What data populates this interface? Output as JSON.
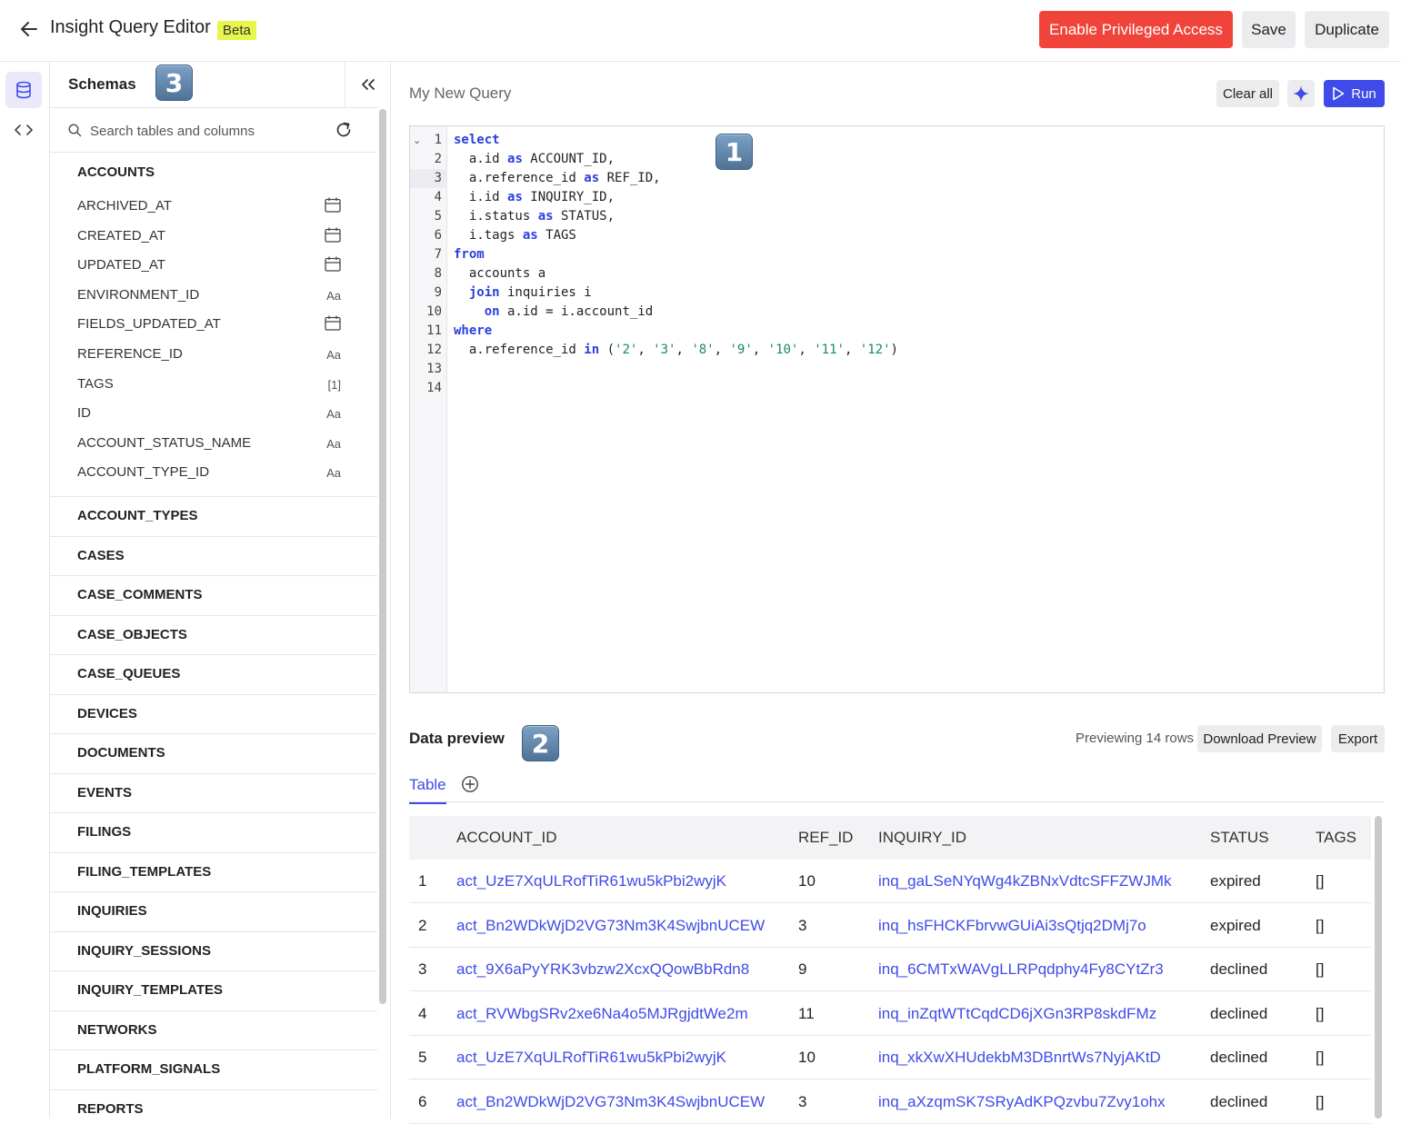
{
  "header": {
    "title": "Insight Query Editor",
    "badge": "Beta",
    "privileged_label": "Enable Privileged Access",
    "save_label": "Save",
    "duplicate_label": "Duplicate",
    "privileged_color": "#f0443a"
  },
  "rail": {
    "items": [
      {
        "icon": "database-icon",
        "active": true
      },
      {
        "icon": "code-icon",
        "active": false
      }
    ]
  },
  "schemas": {
    "title": "Schemas",
    "search_placeholder": "Search tables and columns",
    "expanded_table": "ACCOUNTS",
    "columns": [
      {
        "name": "ARCHIVED_AT",
        "type": "calendar-icon"
      },
      {
        "name": "CREATED_AT",
        "type": "calendar-icon"
      },
      {
        "name": "UPDATED_AT",
        "type": "calendar-icon"
      },
      {
        "name": "ENVIRONMENT_ID",
        "type": "Aa"
      },
      {
        "name": "FIELDS_UPDATED_AT",
        "type": "calendar-icon"
      },
      {
        "name": "REFERENCE_ID",
        "type": "Aa"
      },
      {
        "name": "TAGS",
        "type": "[1]"
      },
      {
        "name": "ID",
        "type": "Aa"
      },
      {
        "name": "ACCOUNT_STATUS_NAME",
        "type": "Aa"
      },
      {
        "name": "ACCOUNT_TYPE_ID",
        "type": "Aa"
      }
    ],
    "tables": [
      "ACCOUNT_TYPES",
      "CASES",
      "CASE_COMMENTS",
      "CASE_OBJECTS",
      "CASE_QUEUES",
      "DEVICES",
      "DOCUMENTS",
      "EVENTS",
      "FILINGS",
      "FILING_TEMPLATES",
      "INQUIRIES",
      "INQUIRY_SESSIONS",
      "INQUIRY_TEMPLATES",
      "NETWORKS",
      "PLATFORM_SIGNALS",
      "REPORTS"
    ]
  },
  "markers": {
    "editor": "1",
    "preview": "2",
    "schemas": "3"
  },
  "query": {
    "name": "My New Query",
    "clear_label": "Clear all",
    "run_label": "Run",
    "run_color": "#3e4be8",
    "line_numbers": [
      "1",
      "2",
      "3",
      "4",
      "5",
      "6",
      "7",
      "8",
      "9",
      "10",
      "11",
      "12",
      "13",
      "14"
    ],
    "active_line": "3"
  },
  "preview": {
    "title": "Data preview",
    "row_count_text": "Previewing 14 rows",
    "download_label": "Download Preview",
    "export_label": "Export",
    "tab_label": "Table",
    "columns": [
      "ACCOUNT_ID",
      "REF_ID",
      "INQUIRY_ID",
      "STATUS",
      "TAGS"
    ],
    "rows": [
      {
        "n": "1",
        "account_id": "act_UzE7XqULRofTiR61wu5kPbi2wyjK",
        "ref_id": "10",
        "inquiry_id": "inq_gaLSeNYqWg4kZBNxVdtcSFFZWJMk",
        "status": "expired",
        "tags": "[]"
      },
      {
        "n": "2",
        "account_id": "act_Bn2WDkWjD2VG73Nm3K4SwjbnUCEW",
        "ref_id": "3",
        "inquiry_id": "inq_hsFHCKFbrvwGUiAi3sQtjq2DMj7o",
        "status": "expired",
        "tags": "[]"
      },
      {
        "n": "3",
        "account_id": "act_9X6aPyYRK3vbzw2XcxQQowBbRdn8",
        "ref_id": "9",
        "inquiry_id": "inq_6CMTxWAVgLLRPqdphy4Fy8CYtZr3",
        "status": "declined",
        "tags": "[]"
      },
      {
        "n": "4",
        "account_id": "act_RVWbgSRv2xe6Na4o5MJRgjdtWe2m",
        "ref_id": "11",
        "inquiry_id": "inq_inZqtWTtCqdCD6jXGn3RP8skdFMz",
        "status": "declined",
        "tags": "[]"
      },
      {
        "n": "5",
        "account_id": "act_UzE7XqULRofTiR61wu5kPbi2wyjK",
        "ref_id": "10",
        "inquiry_id": "inq_xkXwXHUdekbM3DBnrtWs7NyjAKtD",
        "status": "declined",
        "tags": "[]"
      },
      {
        "n": "6",
        "account_id": "act_Bn2WDkWjD2VG73Nm3K4SwjbnUCEW",
        "ref_id": "3",
        "inquiry_id": "inq_aXzqmSK7SRyAdKPQzvbu7Zvy1ohx",
        "status": "declined",
        "tags": "[]"
      }
    ]
  }
}
